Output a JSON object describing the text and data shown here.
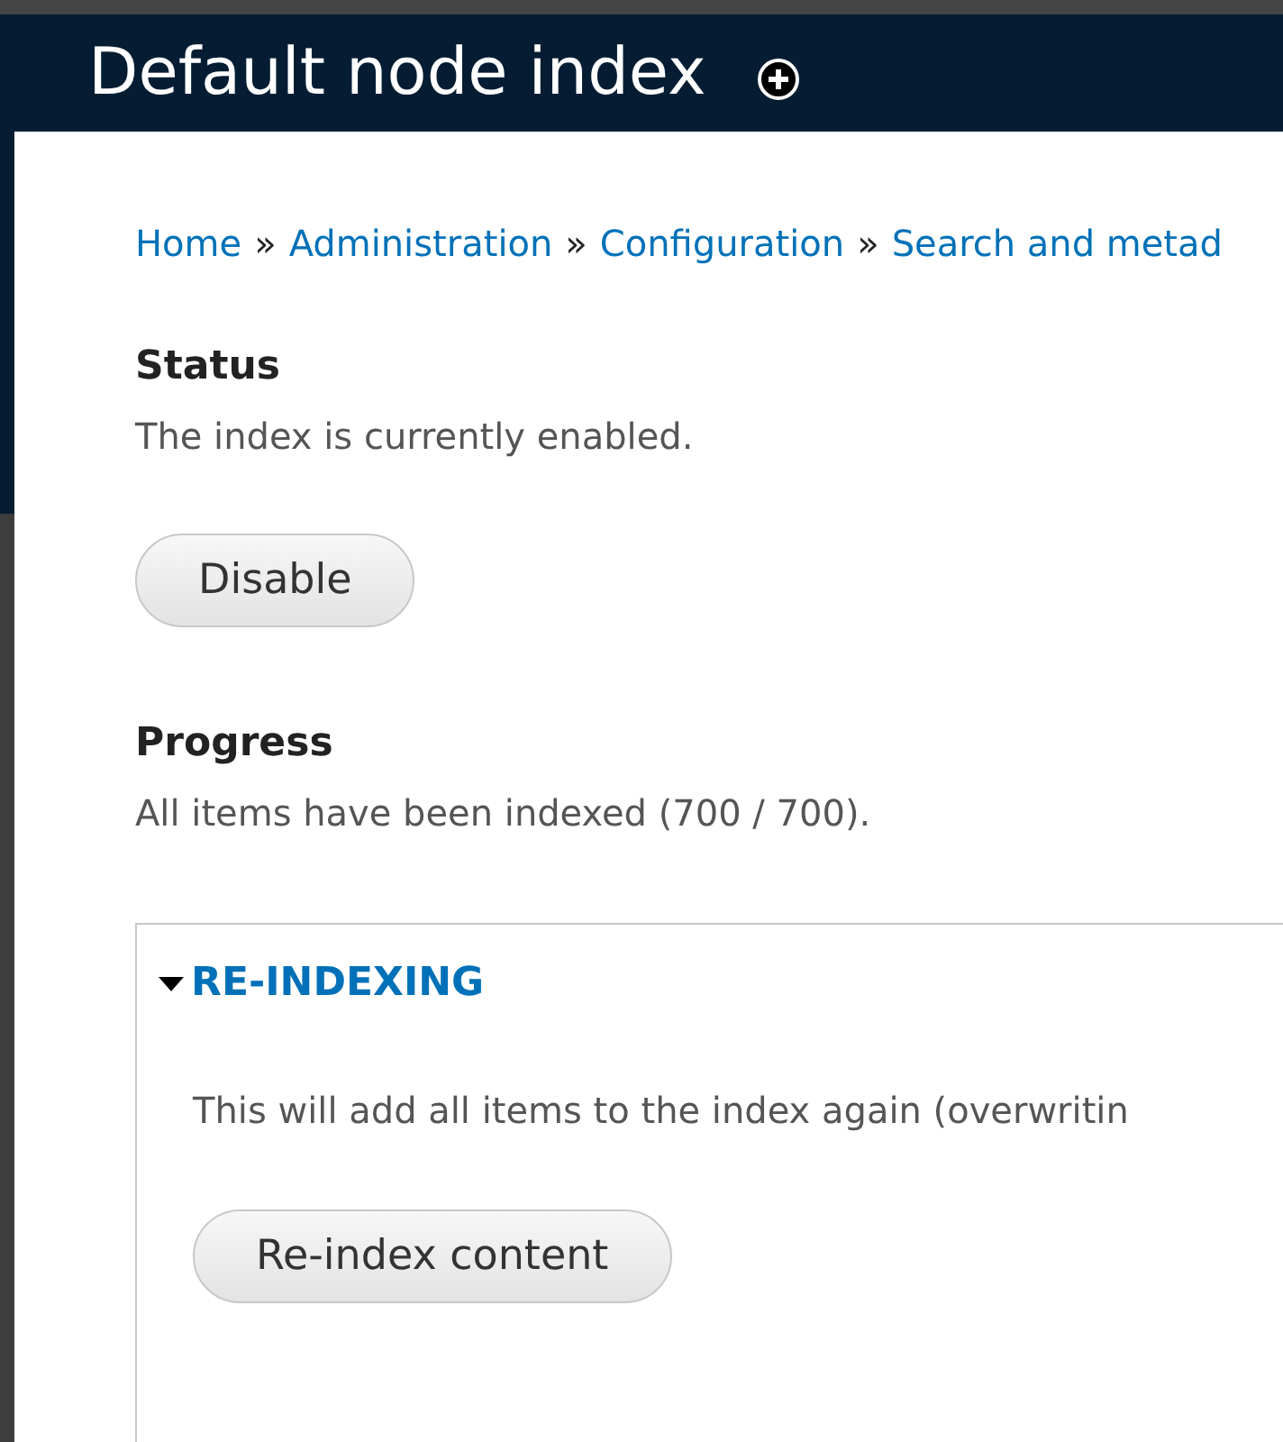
{
  "header": {
    "title": "Default node index"
  },
  "breadcrumb": [
    "Home",
    "Administration",
    "Configuration",
    "Search and metad"
  ],
  "breadcrumb_separator": "»",
  "status": {
    "heading": "Status",
    "text": "The index is currently enabled.",
    "button": "Disable"
  },
  "progress": {
    "heading": "Progress",
    "text": "All items have been indexed (700 / 700)."
  },
  "reindexing": {
    "legend": "RE-INDEXING",
    "expanded": true,
    "text": "This will add all items to the index again (overwritin",
    "button": "Re-index content"
  }
}
